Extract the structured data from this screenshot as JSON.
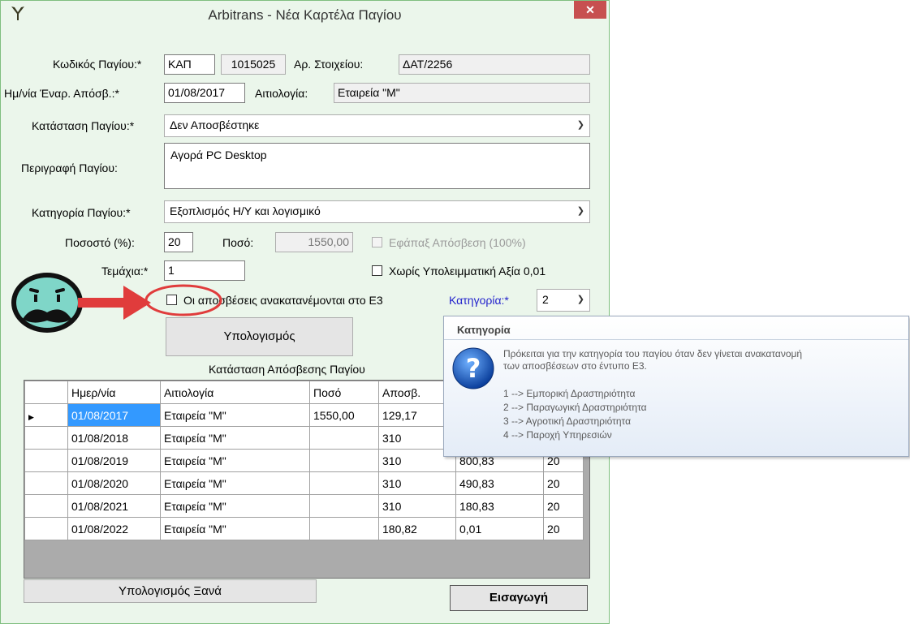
{
  "window": {
    "title": "Arbitrans - Νέα Καρτέλα Παγίου",
    "close_glyph": "✕"
  },
  "form": {
    "code_label": "Κωδικός Παγίου:*",
    "code_prefix": "ΚΑΠ",
    "code_number": "1015025",
    "item_no_label": "Αρ. Στοιχείου:",
    "item_no": "ΔΑΤ/2256",
    "start_date_label": "Ημ/νία Έναρ. Απόσβ.:*",
    "start_date": "01/08/2017",
    "reason_label": "Αιτιολογία:",
    "reason": "Εταιρεία \"Μ\"",
    "status_label": "Κατάσταση Παγίου:*",
    "status_value": "Δεν Αποσβέστηκε",
    "description_label": "Περιγραφή Παγίου:",
    "description": "Αγορά PC Desktop",
    "category_label": "Κατηγορία Παγίου:*",
    "category_value": "Εξοπλισμός Η/Υ και λογισμικό",
    "percent_label": "Ποσοστό (%):",
    "percent": "20",
    "amount_label": "Ποσό:",
    "amount": "1550,00",
    "one_time_label": "Εφάπαξ Απόσβεση (100%)",
    "pieces_label": "Τεμάχια:*",
    "pieces": "1",
    "no_residual_label": "Χωρίς Υπολειμματική Αξία 0,01",
    "redistribute_label": "Οι αποσβέσεις ανακατανέμονται στο Ε3",
    "e3_category_label": "Κατηγορία:*",
    "e3_category_value": "2",
    "calculate_button": "Υπολογισμός",
    "grid_caption": "Κατάσταση Απόσβεσης Παγίου"
  },
  "grid": {
    "columns": [
      "Ημερ/νία",
      "Αιτιολογία",
      "Ποσό",
      "Αποσβ.",
      "",
      ""
    ],
    "rows": [
      [
        "01/08/2017",
        "Εταιρεία \"Μ\"",
        "1550,00",
        "129,17",
        "",
        ""
      ],
      [
        "01/08/2018",
        "Εταιρεία \"Μ\"",
        "",
        "310",
        "",
        ""
      ],
      [
        "01/08/2019",
        "Εταιρεία \"Μ\"",
        "",
        "310",
        "800,83",
        "20"
      ],
      [
        "01/08/2020",
        "Εταιρεία \"Μ\"",
        "",
        "310",
        "490,83",
        "20"
      ],
      [
        "01/08/2021",
        "Εταιρεία \"Μ\"",
        "",
        "310",
        "180,83",
        "20"
      ],
      [
        "01/08/2022",
        "Εταιρεία \"Μ\"",
        "",
        "180,82",
        "0,01",
        "20"
      ]
    ]
  },
  "footer": {
    "recalculate_button": "Υπολογισμός Ξανά",
    "insert_button": "Εισαγωγή"
  },
  "tooltip": {
    "title": "Κατηγορία",
    "text": "Πρόκειται για την κατηγορία του παγίου όταν δεν γίνεται ανακατανομή\nτων αποσβέσεων στο έντυπο Ε3.",
    "items": [
      "1 --> Εμπορική Δραστηριότητα",
      "2 --> Παραγωγική Δραστηριότητα",
      "3 --> Αγροτική Δραστηριότητα",
      "4 --> Παροχή Υπηρεσιών"
    ]
  },
  "colors": {
    "window_bg": "#ebf6eb",
    "selection": "#3399ff",
    "annotation_red": "#e03c3c",
    "link_blue": "#2222cc"
  },
  "icons": {
    "app": "app-logo-icon",
    "help": "question-mark-icon",
    "face": "worried-face-icon",
    "arrow": "red-arrow-icon"
  }
}
